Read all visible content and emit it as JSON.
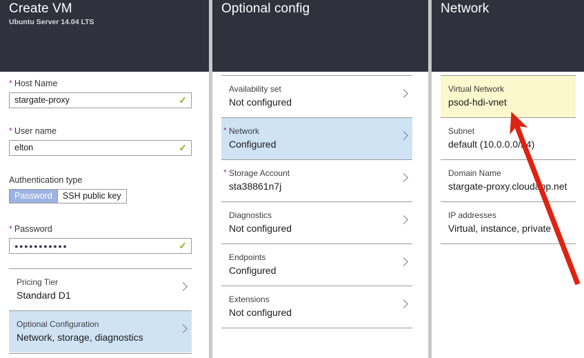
{
  "blades": {
    "create_vm": {
      "title": "Create VM",
      "subtitle": "Ubuntu Server 14.04 LTS",
      "fields": {
        "host_name": {
          "label": "Host Name",
          "required_marker": "*",
          "value": "stargate-proxy",
          "placeholder": "",
          "valid_icon": "check-icon"
        },
        "user_name": {
          "label": "User name",
          "required_marker": "*",
          "value": "elton",
          "placeholder": "",
          "valid_icon": "check-icon"
        },
        "auth_type": {
          "label": "Authentication type",
          "options": [
            "Password",
            "SSH public key"
          ],
          "selected": "Password"
        },
        "password": {
          "label": "Password",
          "required_marker": "*",
          "value": "...........",
          "placeholder": "",
          "valid_icon": "check-icon"
        }
      },
      "rows": [
        {
          "label": "Pricing Tier",
          "value": "Standard D1",
          "required_marker": "",
          "selected": false,
          "chevron": "chevron-right-icon"
        },
        {
          "label": "Optional Configuration",
          "value": "Network, storage, diagnostics",
          "required_marker": "",
          "selected": true,
          "chevron": "chevron-right-icon"
        }
      ]
    },
    "optional_config": {
      "title": "Optional config",
      "subtitle": "",
      "rows": [
        {
          "label": "Availability set",
          "value": "Not configured",
          "required_marker": "",
          "selected": false,
          "chevron": "chevron-right-icon"
        },
        {
          "label": "Network",
          "value": "Configured",
          "required_marker": "*",
          "selected": true,
          "chevron": "chevron-right-icon"
        },
        {
          "label": "Storage Account",
          "value": "sta38861n7j",
          "required_marker": "*",
          "selected": false,
          "chevron": "chevron-right-icon"
        },
        {
          "label": "Diagnostics",
          "value": "Not configured",
          "required_marker": "",
          "selected": false,
          "chevron": "chevron-right-icon"
        },
        {
          "label": "Endpoints",
          "value": "Configured",
          "required_marker": "",
          "selected": false,
          "chevron": "chevron-right-icon"
        },
        {
          "label": "Extensions",
          "value": "Not configured",
          "required_marker": "",
          "selected": false,
          "chevron": "chevron-right-icon"
        }
      ]
    },
    "network": {
      "title": "Network",
      "subtitle": "",
      "rows": [
        {
          "label": "Virtual Network",
          "value": "psod-hdi-vnet",
          "required_marker": "",
          "highlighted": true
        },
        {
          "label": "Subnet",
          "value": "default (10.0.0.0/24)",
          "required_marker": "",
          "highlighted": false
        },
        {
          "label": "Domain Name",
          "value": "stargate-proxy.cloudapp.net",
          "required_marker": "",
          "highlighted": false
        },
        {
          "label": "IP addresses",
          "value": "Virtual, instance, private",
          "required_marker": "",
          "highlighted": false
        }
      ]
    }
  },
  "annotation": {
    "arrow_color": "#e02211",
    "arrow_name": "red-annotation-arrow"
  },
  "colors": {
    "header_bg": "#2f313d",
    "selected_row": "#cfe3f5",
    "highlight_row": "#fbf8cd",
    "required_star": "#9b2fae",
    "valid_check": "#88b81d",
    "toggle_selected": "#9db4e2"
  }
}
